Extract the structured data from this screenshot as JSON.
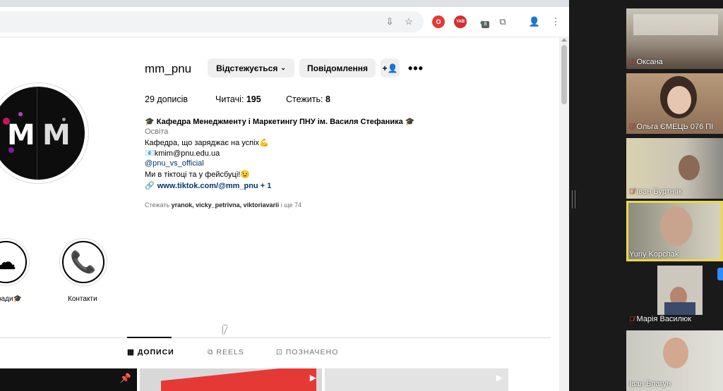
{
  "profile": {
    "username": "mm_pnu",
    "following_button": "Відстежується",
    "message_button": "Повідомлення",
    "stats": {
      "posts": "29 дописів",
      "followers_label": "Читачі:",
      "followers_count": "195",
      "following_label": "Стежить:",
      "following_count": "8"
    },
    "bio": {
      "name": "🎓 Кафедра Менеджменту і Маркетингу ПНУ ім. Василя Стефаника 🎓",
      "category": "Освіта",
      "line1": "Кафедра, що заряджає на успіх💪",
      "email": "📧kmim@pnu.edu.ua",
      "handle": "@pnu_vs_official",
      "line2": "Ми в тіктоці та у фейсбуці!😉",
      "link": "www.tiktok.com/@mm_pnu",
      "link_extra": "+ 1"
    },
    "followed_by": {
      "prefix": "Стежать",
      "names": "yranok, vicky_petrivna, viktoriavarii",
      "suffix": "і ще 74"
    },
    "highlights": [
      {
        "label": "ради🎓",
        "icon": "cloud-icon"
      },
      {
        "label": "Контакти",
        "icon": "phone-icon"
      }
    ],
    "tabs": [
      {
        "label": "ДОПИСИ",
        "icon": "grid-icon",
        "active": true
      },
      {
        "label": "REELS",
        "icon": "reels-icon",
        "active": false
      },
      {
        "label": "ПОЗНАЧЕНО",
        "icon": "tagged-icon",
        "active": false
      }
    ],
    "avatar_text": "M M"
  },
  "zoom": {
    "participants": [
      {
        "name": "Оксана",
        "muted": true
      },
      {
        "name": "Ольга ЄМЕЦЬ 076 ПІ",
        "muted": true
      },
      {
        "name": "Іван Буртняк",
        "muted": true
      },
      {
        "name": "Yuriy Kopchak",
        "muted": false,
        "speaking": true
      },
      {
        "name": "Марія Василюк",
        "muted": true
      },
      {
        "name": "Іван Благун",
        "muted": false
      }
    ]
  },
  "colors": {
    "accent_link": "#00376b",
    "zoom_speaker": "#e8d94a",
    "muted_mic": "#ff4a4a"
  }
}
